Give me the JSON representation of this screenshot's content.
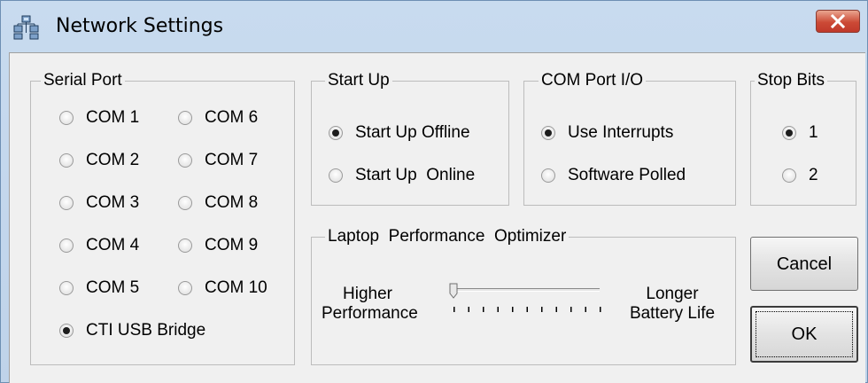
{
  "window": {
    "title": "Network Settings",
    "close_label": "close"
  },
  "serial_port": {
    "label": "Serial Port",
    "options": [
      "COM 1",
      "COM 2",
      "COM 3",
      "COM 4",
      "COM 5",
      "COM 6",
      "COM 7",
      "COM 8",
      "COM 9",
      "COM 10",
      "CTI USB Bridge"
    ],
    "selected": "CTI USB Bridge"
  },
  "start_up": {
    "label": "Start Up",
    "options": [
      "Start Up Offline",
      "Start Up  Online"
    ],
    "selected": "Start Up Offline"
  },
  "com_port_io": {
    "label": "COM Port I/O",
    "options": [
      "Use Interrupts",
      "Software Polled"
    ],
    "selected": "Use Interrupts"
  },
  "stop_bits": {
    "label": "Stop Bits",
    "options": [
      "1",
      "2"
    ],
    "selected": "1"
  },
  "optimizer": {
    "label": "Laptop  Performance  Optimizer",
    "left_label_1": "Higher",
    "left_label_2": "Performance",
    "right_label_1": "Longer",
    "right_label_2": "Battery Life",
    "slider_value": 0,
    "slider_min": 0,
    "slider_max": 10
  },
  "buttons": {
    "cancel": "Cancel",
    "ok": "OK"
  },
  "colors": {
    "close_button": "#c0392b",
    "dialog_bg": "#f0f0f0",
    "frame": "#bfd3ea"
  }
}
